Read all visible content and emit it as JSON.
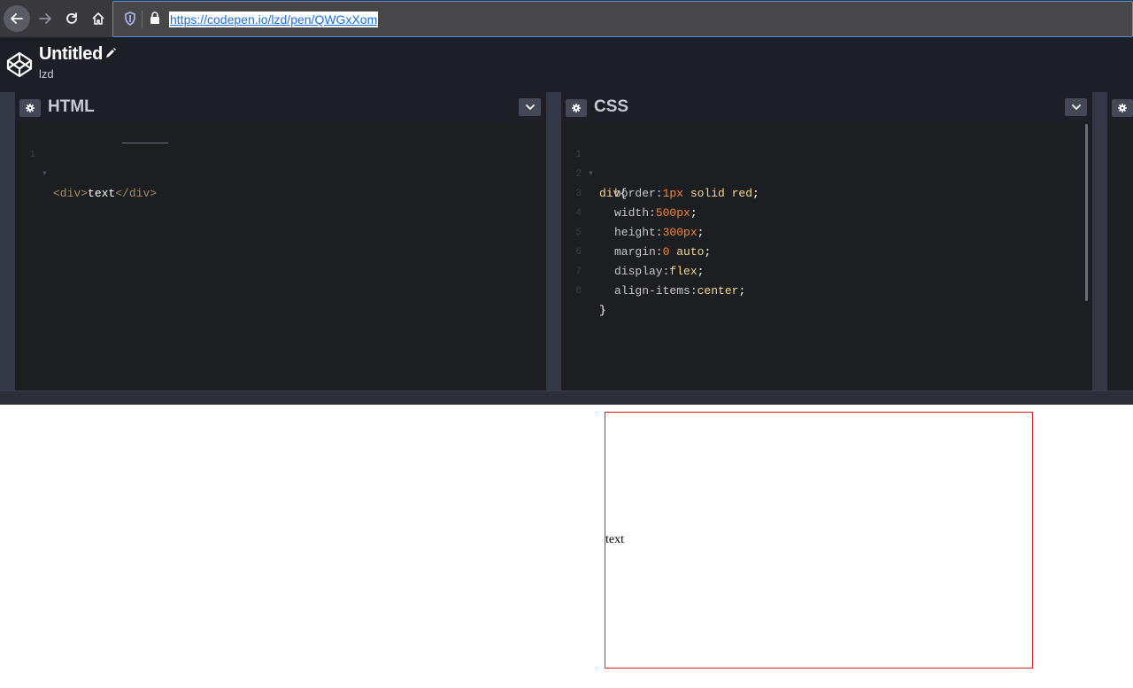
{
  "browser": {
    "url": "https://codepen.io/lzd/pen/QWGxXom"
  },
  "pen": {
    "title": "Untitled",
    "user": "lzd"
  },
  "editors": {
    "html": {
      "title": "HTML"
    },
    "css": {
      "title": "CSS"
    }
  },
  "html_code": {
    "line_numbers": [
      "1"
    ],
    "open_tag": "<div>",
    "content": "text",
    "close_tag": "</div>"
  },
  "css_code": {
    "line_numbers": [
      "1",
      "2",
      "3",
      "4",
      "5",
      "6",
      "7",
      "8"
    ],
    "selector": "div",
    "open_brace": "{",
    "close_brace": "}",
    "declarations": [
      {
        "prop": "border:",
        "num": "1px",
        "rest": " solid red",
        "semi": ";"
      },
      {
        "prop": "width:",
        "num": "500px",
        "rest": "",
        "semi": ";"
      },
      {
        "prop": "height:",
        "num": "300px",
        "rest": "",
        "semi": ";"
      },
      {
        "prop": "margin:",
        "num": "0",
        "rest": " auto",
        "semi": ";"
      },
      {
        "prop": "display:",
        "num": "",
        "rest": "flex",
        "semi": ";"
      },
      {
        "prop": "align-items:",
        "num": "",
        "rest": "center",
        "semi": ";"
      }
    ]
  },
  "preview": {
    "text": "text",
    "border_color": "#e02020"
  },
  "colors": {
    "header_bg": "#1e1f26",
    "editor_bg": "#1d1e22",
    "accent": "#4f8df7"
  }
}
